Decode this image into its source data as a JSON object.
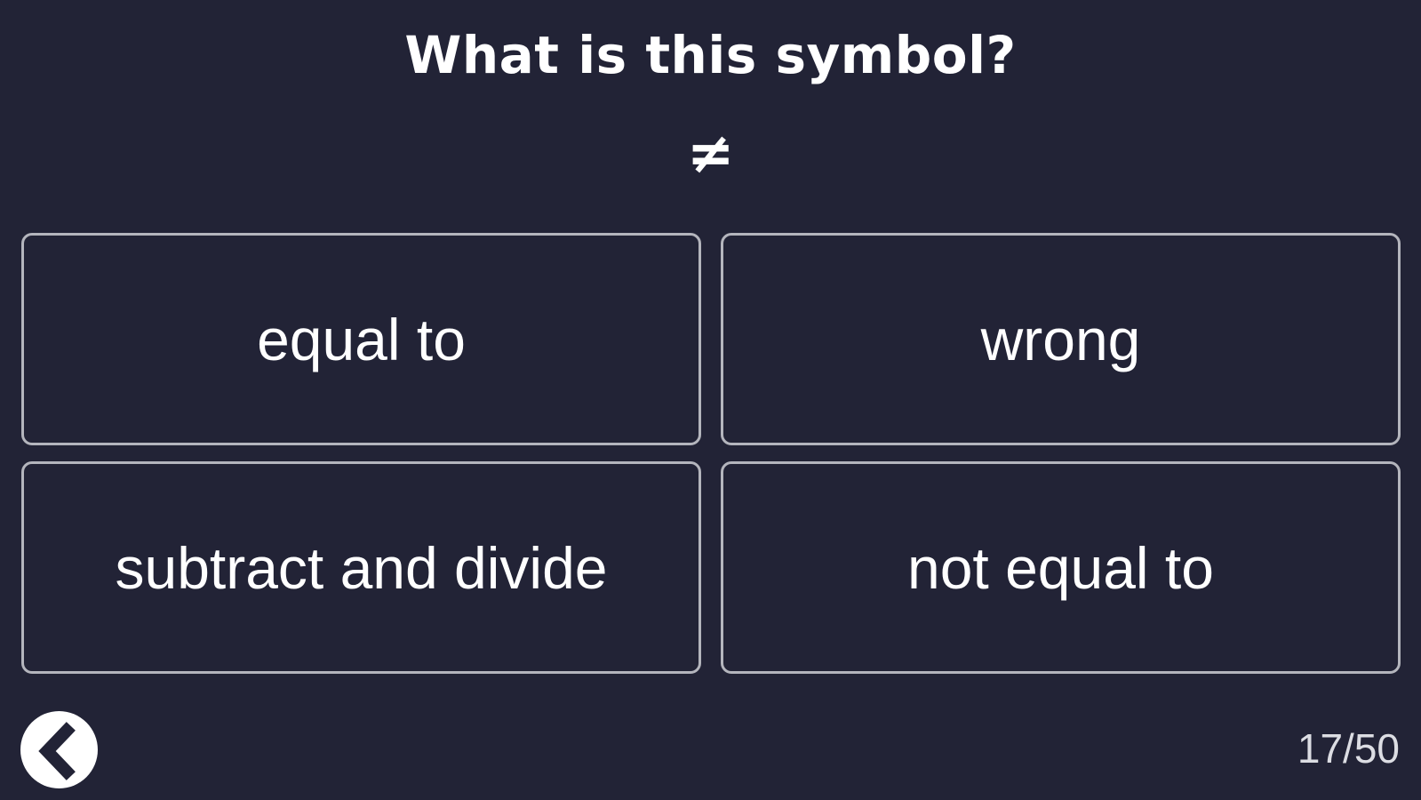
{
  "quiz": {
    "question": "What is this symbol?",
    "symbol": "≠",
    "answers": [
      {
        "label": "equal to"
      },
      {
        "label": "wrong"
      },
      {
        "label": "subtract and divide"
      },
      {
        "label": "not equal to"
      }
    ]
  },
  "footer": {
    "back_icon": "chevron-left-icon",
    "progress": "17/50"
  },
  "colors": {
    "background": "#222336",
    "text": "#ffffff",
    "answer_border": "#b4b5bd"
  }
}
